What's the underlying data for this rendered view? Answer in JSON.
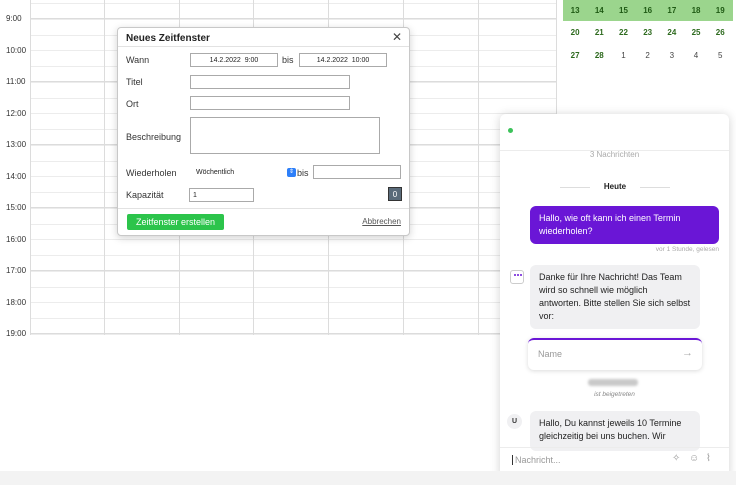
{
  "calendar": {
    "hours": [
      "9:00",
      "10:00",
      "11:00",
      "12:00",
      "13:00",
      "14:00",
      "15:00",
      "16:00",
      "17:00",
      "18:00",
      "19:00"
    ]
  },
  "mini_month": {
    "rows": [
      [
        "13",
        "14",
        "15",
        "16",
        "17",
        "18",
        "19"
      ],
      [
        "20",
        "21",
        "22",
        "23",
        "24",
        "25",
        "26"
      ],
      [
        "27",
        "28",
        "1",
        "2",
        "3",
        "4",
        "5"
      ]
    ]
  },
  "dialog": {
    "title": "Neues Zeitfenster",
    "close": "✕",
    "when_label": "Wann",
    "start_value": "14.2.2022  9:00",
    "until_label": "bis",
    "end_value": "14.2.2022  10:00",
    "title_label": "Titel",
    "title_value": "",
    "location_label": "Ort",
    "location_value": "",
    "description_label": "Beschreibung",
    "description_value": "",
    "repeat_label": "Wiederholen",
    "repeat_value": "Wöchentlich",
    "repeat_until_label": "bis",
    "repeat_until_value": "",
    "capacity_label": "Kapazität",
    "capacity_value": "1",
    "capacity_badge": "0",
    "create_label": "Zeitfenster erstellen",
    "cancel_label": "Abbrechen"
  },
  "chat": {
    "message_count": "3 Nachrichten",
    "today": "Heute",
    "msg_user_1": "Hallo, wie oft kann ich einen Termin wiederholen?",
    "msg_user_1_meta": "vor 1 Stunde, gelesen",
    "msg_bot_1": "Danke für Ihre Nachricht! Das Team wird so schnell wie möglich antworten. Bitte stellen Sie sich selbst vor:",
    "name_placeholder": "Name",
    "joined_text": "ist beigetreten",
    "agent_initial": "U",
    "msg_agent_1": "Hallo, Du kannst jeweils 10 Termine gleichzeitig bei uns buchen. Wir",
    "input_placeholder": "Nachricht...",
    "icons": {
      "send": "arrow-right-icon",
      "magic": "sparkle-icon",
      "emoji": "smiley-icon",
      "attach": "paperclip-icon"
    },
    "accent_color": "#6a16d6"
  }
}
